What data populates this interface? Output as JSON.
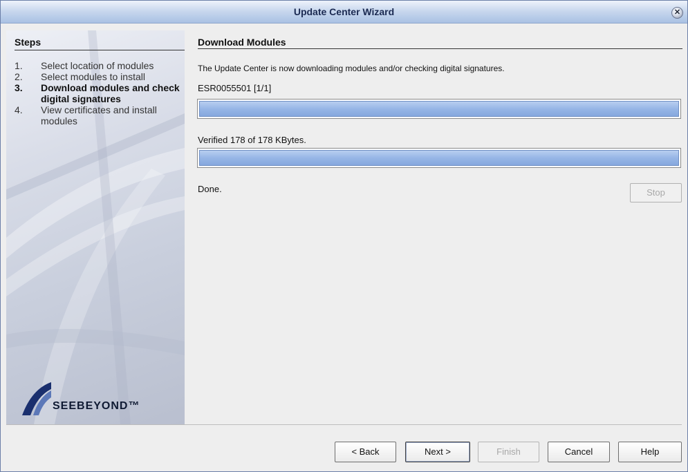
{
  "window": {
    "title": "Update Center Wizard",
    "close_glyph": "✕"
  },
  "steps": {
    "heading": "Steps",
    "items": [
      {
        "num": "1.",
        "label": "Select location of modules",
        "current": false
      },
      {
        "num": "2.",
        "label": "Select modules to install",
        "current": false
      },
      {
        "num": "3.",
        "label": "Download modules and check digital signatures",
        "current": true
      },
      {
        "num": "4.",
        "label": "View certificates and install modules",
        "current": false
      }
    ]
  },
  "branding": {
    "logo_text": "SEEBEYOND™"
  },
  "content": {
    "heading": "Download Modules",
    "message": "The Update Center is now downloading modules and/or checking digital signatures.",
    "module_label": "ESR0055501 [1/1]",
    "module_progress": 1.0,
    "verify_label": "Verified 178 of 178 KBytes.",
    "verify_progress": 1.0,
    "status": "Done.",
    "stop_label": "Stop"
  },
  "buttons": {
    "back": "< Back",
    "next": "Next >",
    "finish": "Finish",
    "cancel": "Cancel",
    "help": "Help"
  },
  "colors": {
    "progress_fill": "#97b6e6",
    "title_text": "#1b2a52"
  }
}
